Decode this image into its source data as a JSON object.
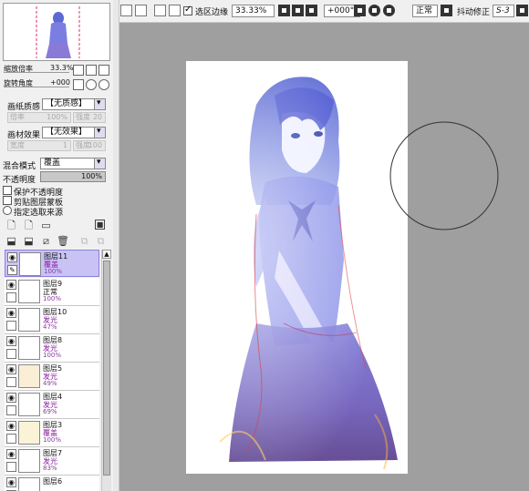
{
  "navigator": {
    "zoom_label": "缩放倍率",
    "zoom_value": "33.3%",
    "rotate_label": "旋转角度",
    "rotate_value": "+000"
  },
  "paper": {
    "texture_label": "画纸质感",
    "texture_value": "【无质感】",
    "scale_label": "倍率",
    "scale_value": "100%",
    "strength_label": "强度",
    "strength_value": "20",
    "effect_label": "画材效果",
    "effect_value": "【无效果】",
    "width_label": "宽度",
    "width_value": "1",
    "effect_strength_label": "强度",
    "effect_strength_value": "100"
  },
  "blend": {
    "mode_label": "混合模式",
    "mode_value": "覆盖",
    "opacity_label": "不透明度",
    "opacity_value": "100%",
    "opacity_fraction": 1.0
  },
  "options": [
    {
      "label": "保护不透明度",
      "checked": false
    },
    {
      "label": "剪贴图层蒙板",
      "checked": false
    },
    {
      "label": "指定选取来源",
      "checked": false
    }
  ],
  "layers": [
    {
      "name": "图层11",
      "mode": "覆盖",
      "opacity": "100%",
      "selected": true
    },
    {
      "name": "图层9",
      "mode": "正常",
      "opacity": "100%",
      "selected": false
    },
    {
      "name": "图层10",
      "mode": "发光",
      "opacity": "47%",
      "selected": false
    },
    {
      "name": "图层8",
      "mode": "发光",
      "opacity": "100%",
      "selected": false
    },
    {
      "name": "图层5",
      "mode": "发光",
      "opacity": "49%",
      "selected": false
    },
    {
      "name": "图层4",
      "mode": "发光",
      "opacity": "69%",
      "selected": false
    },
    {
      "name": "图层3",
      "mode": "覆盖",
      "opacity": "100%",
      "selected": false
    },
    {
      "name": "图层7",
      "mode": "发光",
      "opacity": "83%",
      "selected": false
    },
    {
      "name": "图层6",
      "mode": "",
      "opacity": "",
      "selected": false
    }
  ],
  "toolbar": {
    "selection_edge_label": "选区边缘",
    "selection_edge_checked": true,
    "zoom_value": "33.33%",
    "rotate_value": "+000°",
    "blend_mode": "正常",
    "stabilizer_label": "抖动修正",
    "stabilizer_value": "S-3"
  },
  "colors": {
    "canvas_bg": "#9f9f9f",
    "selected_layer": "#c9c3f5",
    "mode_text": "#8a1aa0"
  }
}
